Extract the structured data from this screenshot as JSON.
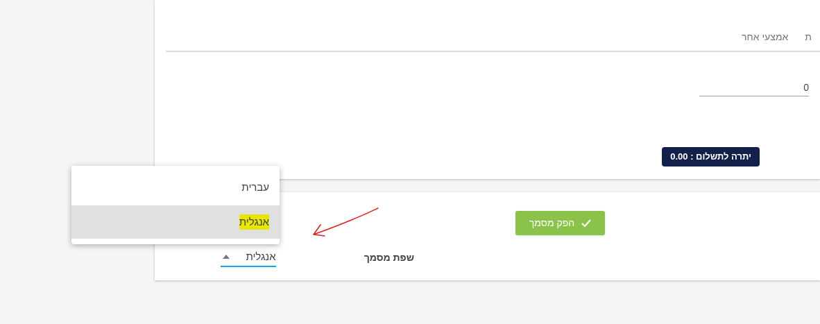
{
  "tabs": [
    {
      "label": "ת",
      "selected": false
    },
    {
      "label": "אמצעי אחר",
      "selected": false
    }
  ],
  "amount_field": {
    "value": "0"
  },
  "balance_badge": "יתרה לתשלום : 0.00",
  "produce_button": "הפק מסמך",
  "language": {
    "label": "שפת מסמך",
    "value": "אנגלית",
    "expanded": true,
    "options": [
      {
        "label": "עברית",
        "selected": false,
        "highlighted": false
      },
      {
        "label": "אנגלית",
        "selected": true,
        "highlighted": true
      }
    ]
  }
}
